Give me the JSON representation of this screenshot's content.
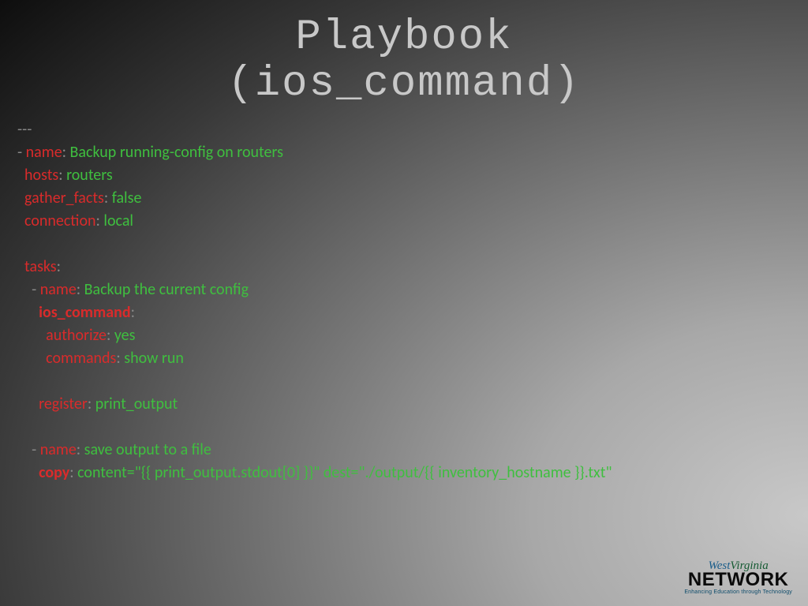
{
  "title": {
    "line1": "Playbook",
    "line2": "(ios_command)"
  },
  "code": {
    "sep": "---",
    "dash": "- ",
    "colon": ": ",
    "name_key": "name",
    "play_name": "Backup running-config on routers",
    "hosts_key": "hosts",
    "hosts_val": "routers",
    "gather_key": "gather_facts",
    "gather_val": "false",
    "conn_key": "connection",
    "conn_val": "local",
    "tasks_key": "tasks",
    "task1_name": "Backup the current config",
    "ios_cmd_key": "ios_command",
    "auth_key": "authorize",
    "auth_val": "yes",
    "cmds_key": "commands",
    "cmds_val": "show run",
    "reg_key": "register",
    "reg_val": "print_output",
    "task2_name": "save output to a file",
    "copy_key": "copy",
    "copy_val": "content=\"{{ print_output.stdout[0] }}\" dest=\"./output/{{ inventory_hostname }}.txt\""
  },
  "logo": {
    "top1": "West",
    "top2": "Virginia",
    "mid": "NETWORK",
    "bot": "Enhancing Education through Technology"
  }
}
